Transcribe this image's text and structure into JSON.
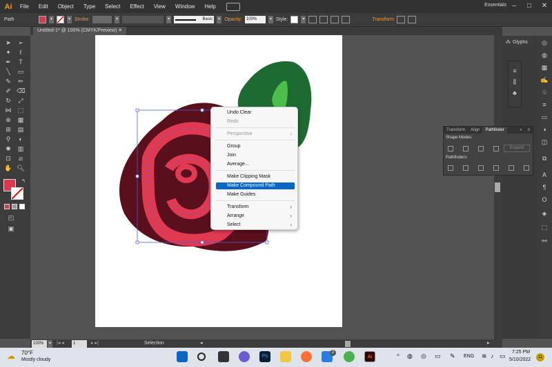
{
  "menubar": {
    "logo": "Ai",
    "items": [
      "File",
      "Edit",
      "Object",
      "Type",
      "Select",
      "Effect",
      "View",
      "Window",
      "Help"
    ],
    "workspace": "Essentials"
  },
  "control": {
    "selection": "Path",
    "stroke_label": "Stroke:",
    "brush": "Basic",
    "opacity_label": "Opacity:",
    "opacity": "100%",
    "style_label": "Style:",
    "transform_label": "Transform",
    "fill_color": "#d93a4f"
  },
  "document": {
    "tab": "Untitled-1* @ 100% (CMYK/Preview)"
  },
  "panels": {
    "glyphs": "Glyphs",
    "pathfinder": {
      "tabs": [
        "Transform",
        "Align",
        "Pathfinder"
      ],
      "shape_modes": "Shape Modes:",
      "pathfinders": "Pathfinders:",
      "expand": "Expand"
    }
  },
  "context_menu": {
    "items": [
      {
        "label": "Undo Clear",
        "disabled": false,
        "submenu": false
      },
      {
        "label": "Redo",
        "disabled": true,
        "submenu": false
      },
      {
        "label": "Perspective",
        "disabled": true,
        "submenu": true
      },
      {
        "label": "Group",
        "disabled": false,
        "submenu": false
      },
      {
        "label": "Join",
        "disabled": false,
        "submenu": false
      },
      {
        "label": "Average...",
        "disabled": false,
        "submenu": false
      },
      {
        "label": "Make Clipping Mask",
        "disabled": false,
        "submenu": false
      },
      {
        "label": "Make Compound Path",
        "disabled": false,
        "submenu": false,
        "highlighted": true
      },
      {
        "label": "Make Guides",
        "disabled": false,
        "submenu": false
      },
      {
        "label": "Transform",
        "disabled": false,
        "submenu": true
      },
      {
        "label": "Arrange",
        "disabled": false,
        "submenu": true
      },
      {
        "label": "Select",
        "disabled": false,
        "submenu": true
      }
    ]
  },
  "statusbar": {
    "zoom": "100%",
    "artboard": "1",
    "mode": "Selection"
  },
  "taskbar": {
    "temperature": "70°F",
    "weather": "Mostly cloudy",
    "language": "ENG",
    "time": "7:25 PM",
    "date": "5/10/2022",
    "badge": "2",
    "notif": "11"
  },
  "colors": {
    "rose_dark": "#5a0f1c",
    "rose_red": "#e03a52",
    "leaf_dark": "#1d6b32",
    "leaf_light": "#4cbf4a",
    "selection": "#4d5fd8",
    "highlight": "#0a66c2"
  }
}
